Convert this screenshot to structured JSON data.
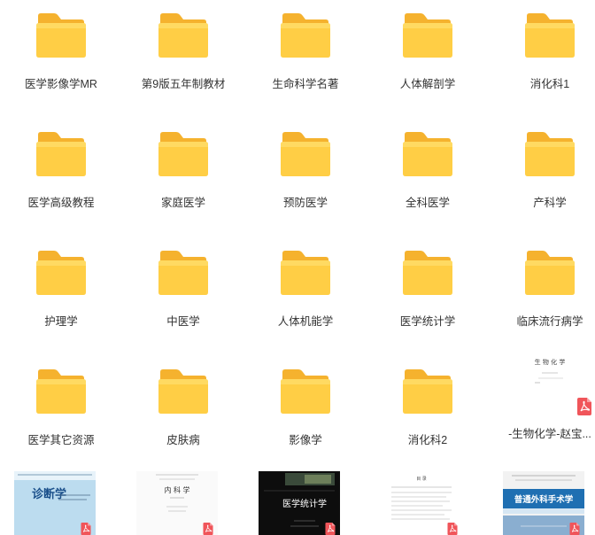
{
  "folders": [
    {
      "label": "医学影像学MR"
    },
    {
      "label": "第9版五年制教材"
    },
    {
      "label": "生命科学名著"
    },
    {
      "label": "人体解剖学"
    },
    {
      "label": "消化科1"
    },
    {
      "label": "医学高级教程"
    },
    {
      "label": "家庭医学"
    },
    {
      "label": "预防医学"
    },
    {
      "label": "全科医学"
    },
    {
      "label": "产科学"
    },
    {
      "label": "护理学"
    },
    {
      "label": "中医学"
    },
    {
      "label": "人体机能学"
    },
    {
      "label": "医学统计学"
    },
    {
      "label": "临床流行病学"
    },
    {
      "label": "医学其它资源"
    },
    {
      "label": "皮肤病"
    },
    {
      "label": "影像学"
    },
    {
      "label": "消化科2"
    }
  ],
  "pdf_file": {
    "label": "-生物化学-赵宝...",
    "cover_title": "生 物 化 学"
  },
  "bottom_files": [
    {
      "cover_title": "诊断学"
    },
    {
      "cover_title": "内 科 学"
    },
    {
      "cover_title": "医学统计学"
    },
    {
      "cover_title": "目 录"
    },
    {
      "cover_title": "普通外科手术学"
    }
  ],
  "colors": {
    "folder_back": "#F7B934",
    "folder_front": "#FFD24A",
    "pdf_red": "#F0555A"
  },
  "icons": {
    "folder": "folder-icon",
    "pdf": "pdf-icon"
  }
}
